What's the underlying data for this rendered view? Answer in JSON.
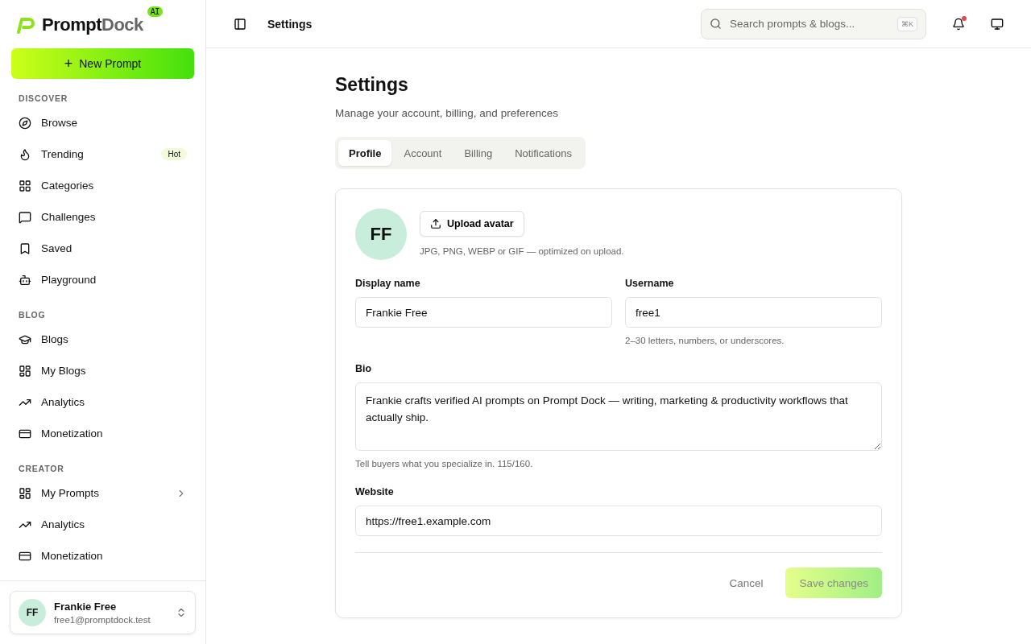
{
  "brand": {
    "name_dark": "Prompt",
    "name_light": "Dock",
    "badge": "AI"
  },
  "new_prompt_button": {
    "icon": "+",
    "label": "New Prompt"
  },
  "sidebar": {
    "sections": [
      {
        "title": "DISCOVER",
        "items": [
          {
            "label": "Browse",
            "selected": false
          },
          {
            "label": "Trending",
            "selected": false,
            "badge": "Hot"
          },
          {
            "label": "Categories",
            "selected": false
          },
          {
            "label": "Challenges",
            "selected": false
          },
          {
            "label": "Saved",
            "selected": false
          },
          {
            "label": "Playground",
            "selected": false
          }
        ]
      },
      {
        "title": "BLOG",
        "items": [
          {
            "label": "Blogs",
            "selected": false
          },
          {
            "label": "My Blogs",
            "selected": false
          },
          {
            "label": "Analytics",
            "selected": false
          },
          {
            "label": "Monetization",
            "selected": false
          }
        ]
      },
      {
        "title": "CREATOR",
        "items": [
          {
            "label": "My Prompts",
            "selected": false,
            "expandable": true
          },
          {
            "label": "Analytics",
            "selected": false
          },
          {
            "label": "Monetization",
            "selected": false
          }
        ]
      }
    ]
  },
  "user": {
    "initials": "FF",
    "name": "Frankie Free",
    "email": "free1@promptdock.test"
  },
  "header": {
    "title": "Settings",
    "search": {
      "placeholder": "Search prompts & blogs...",
      "shortcut": "⌘K"
    },
    "has_notification": true
  },
  "page": {
    "title": "Settings",
    "subtitle": "Manage your account, billing, and preferences"
  },
  "tabs": [
    {
      "label": "Profile",
      "selected": true
    },
    {
      "label": "Account",
      "selected": false
    },
    {
      "label": "Billing",
      "selected": false
    },
    {
      "label": "Notifications",
      "selected": false
    }
  ],
  "profile": {
    "avatar_initials": "FF",
    "upload_button": "Upload avatar",
    "upload_hint": "JPG, PNG, WEBP or GIF — optimized on upload.",
    "fields": [
      {
        "label": "Display name",
        "value": "Frankie Free"
      },
      {
        "label": "Username",
        "value": "free1",
        "hint": "2–30 letters, numbers, or underscores."
      }
    ],
    "bio": {
      "label": "Bio",
      "value": "Frankie crafts verified AI prompts on Prompt Dock — writing, marketing & productivity workflows that actually ship.",
      "hint": "Tell buyers what you specialize in. 115/160."
    },
    "website": {
      "label": "Website",
      "value": "https://free1.example.com"
    },
    "cancel_button": "Cancel",
    "save_button": {
      "label": "Save changes",
      "disabled": true
    }
  }
}
